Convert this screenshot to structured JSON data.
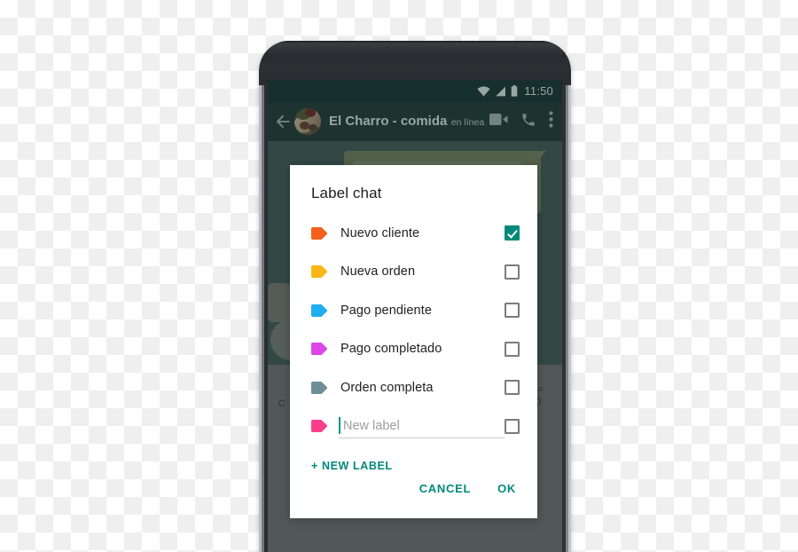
{
  "phone": {
    "statusbar": {
      "time": "11:50",
      "icons": [
        "wifi-icon",
        "signal-icon",
        "battery-icon"
      ]
    },
    "appbar": {
      "back_icon": "back-arrow-icon",
      "avatar": "contact-avatar",
      "title": "El Charro - comida",
      "subtitle": "en línea",
      "actions": [
        "video-call-icon",
        "voice-call-icon",
        "overflow-menu-icon"
      ]
    }
  },
  "dialog": {
    "title": "Label chat",
    "labels": [
      {
        "name": "Nuevo cliente",
        "color": "#F4601A",
        "checked": true
      },
      {
        "name": "Nueva orden",
        "color": "#FBB615",
        "checked": false
      },
      {
        "name": "Pago pendiente",
        "color": "#1FAEEF",
        "checked": false
      },
      {
        "name": "Pago completado",
        "color": "#DD45E8",
        "checked": false
      },
      {
        "name": "Orden completa",
        "color": "#6D8E96",
        "checked": false
      }
    ],
    "new_label_row": {
      "color": "#FB3E8C",
      "value": "",
      "placeholder": "New label",
      "checked": false
    },
    "new_label_button": "+ NEW LABEL",
    "cancel_button": "CANCEL",
    "ok_button": "OK",
    "accent_color": "#00897B"
  }
}
